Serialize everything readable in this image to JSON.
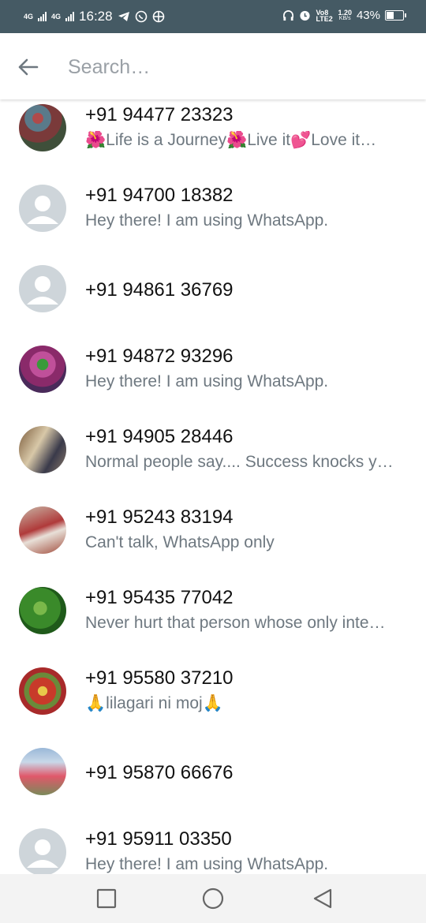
{
  "status_bar": {
    "net1": "4G",
    "net2": "4G",
    "time": "16:28",
    "volte": "Vo8 LTE2",
    "speed_value": "1.20",
    "speed_unit": "KB/s",
    "battery": "43%",
    "icons_left": [
      "telegram-icon",
      "whatsapp-icon",
      "app-icon"
    ],
    "icons_right": [
      "headphones-icon",
      "alarm-icon"
    ]
  },
  "search": {
    "placeholder": "Search…",
    "value": ""
  },
  "contacts": [
    {
      "name": "+91 94477 23323",
      "about": "🌺Life is a Journey🌺Live it💕Love it…",
      "avatar": "photo"
    },
    {
      "name": "+91 94700 18382",
      "about": "Hey there! I am using WhatsApp.",
      "avatar": "default"
    },
    {
      "name": "+91 94861 36769",
      "about": "",
      "avatar": "default"
    },
    {
      "name": "+91 94872 93296",
      "about": "Hey there! I am using WhatsApp.",
      "avatar": "photo"
    },
    {
      "name": "+91 94905 28446",
      "about": "Normal people say.... Success knocks y…",
      "avatar": "photo"
    },
    {
      "name": "+91 95243 83194",
      "about": "Can't talk, WhatsApp only",
      "avatar": "photo"
    },
    {
      "name": "+91 95435 77042",
      "about": "Never hurt that person whose only inte…",
      "avatar": "photo"
    },
    {
      "name": "+91 95580 37210",
      "about": "🙏lilagari ni moj🙏",
      "avatar": "photo"
    },
    {
      "name": "+91 95870 66676",
      "about": "",
      "avatar": "photo"
    },
    {
      "name": "+91 95911 03350",
      "about": "Hey there! I am using WhatsApp.",
      "avatar": "default"
    }
  ],
  "colors": {
    "status_bar": "#455a64",
    "subtitle": "#6e7880",
    "default_avatar_bg": "#ced5da"
  }
}
